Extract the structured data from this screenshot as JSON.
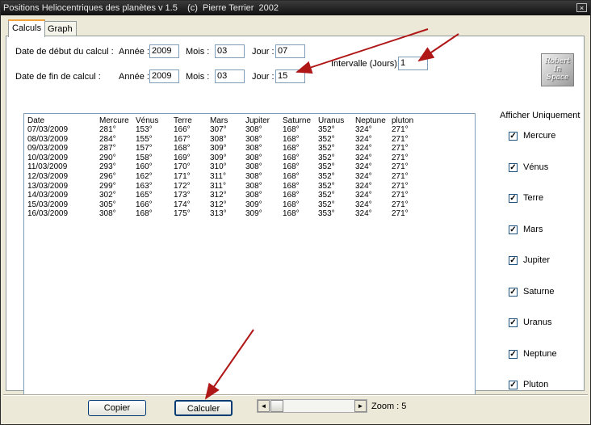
{
  "window": {
    "title": "Positions Heliocentriques des planètes v 1.5    (c)  Pierre Terrier  2002",
    "close_glyph": "×"
  },
  "tabs": [
    "Calculs",
    "Graph"
  ],
  "form": {
    "start_label": "Date de début du calcul :",
    "end_label": "Date de fin de calcul :",
    "year_label": "Année :",
    "month_label": "Mois :",
    "day_label": "Jour :",
    "start": {
      "year": "2009",
      "month": "03",
      "day": "07"
    },
    "end": {
      "year": "2009",
      "month": "03",
      "day": "15"
    },
    "interval_label": "Intervalle (Jours):",
    "interval": "1"
  },
  "logo": [
    "Robert",
    "In",
    "Space"
  ],
  "table": {
    "headers": [
      "Date",
      "Mercure",
      "Vénus",
      "Terre",
      "Mars",
      "Jupiter",
      "Saturne",
      "Uranus",
      "Neptune",
      "pluton"
    ],
    "rows": [
      [
        "07/03/2009",
        "281°",
        "153°",
        "166°",
        "307°",
        "308°",
        "168°",
        "352°",
        "324°",
        "271°"
      ],
      [
        "08/03/2009",
        "284°",
        "155°",
        "167°",
        "308°",
        "308°",
        "168°",
        "352°",
        "324°",
        "271°"
      ],
      [
        "09/03/2009",
        "287°",
        "157°",
        "168°",
        "309°",
        "308°",
        "168°",
        "352°",
        "324°",
        "271°"
      ],
      [
        "10/03/2009",
        "290°",
        "158°",
        "169°",
        "309°",
        "308°",
        "168°",
        "352°",
        "324°",
        "271°"
      ],
      [
        "11/03/2009",
        "293°",
        "160°",
        "170°",
        "310°",
        "308°",
        "168°",
        "352°",
        "324°",
        "271°"
      ],
      [
        "12/03/2009",
        "296°",
        "162°",
        "171°",
        "311°",
        "308°",
        "168°",
        "352°",
        "324°",
        "271°"
      ],
      [
        "13/03/2009",
        "299°",
        "163°",
        "172°",
        "311°",
        "308°",
        "168°",
        "352°",
        "324°",
        "271°"
      ],
      [
        "14/03/2009",
        "302°",
        "165°",
        "173°",
        "312°",
        "308°",
        "168°",
        "352°",
        "324°",
        "271°"
      ],
      [
        "15/03/2009",
        "305°",
        "166°",
        "174°",
        "312°",
        "309°",
        "168°",
        "352°",
        "324°",
        "271°"
      ],
      [
        "16/03/2009",
        "308°",
        "168°",
        "175°",
        "313°",
        "309°",
        "168°",
        "353°",
        "324°",
        "271°"
      ]
    ]
  },
  "filter": {
    "title": "Afficher Uniquement",
    "planets": [
      {
        "label": "Mercure",
        "checked": true
      },
      {
        "label": "Vénus",
        "checked": true
      },
      {
        "label": "Terre",
        "checked": true
      },
      {
        "label": "Mars",
        "checked": true
      },
      {
        "label": "Jupiter",
        "checked": true
      },
      {
        "label": "Saturne",
        "checked": true
      },
      {
        "label": "Uranus",
        "checked": true
      },
      {
        "label": "Neptune",
        "checked": true
      },
      {
        "label": "Pluton",
        "checked": true
      }
    ],
    "check_glyph": "✓"
  },
  "bottom": {
    "copy_label": "Copier",
    "calc_label": "Calculer",
    "zoom_label": "Zoom : 5",
    "zoom_value": 5,
    "left_glyph": "◄",
    "right_glyph": "►"
  },
  "colors": {
    "arrow": "#b01818",
    "tab_highlight": "#f2a33a"
  }
}
